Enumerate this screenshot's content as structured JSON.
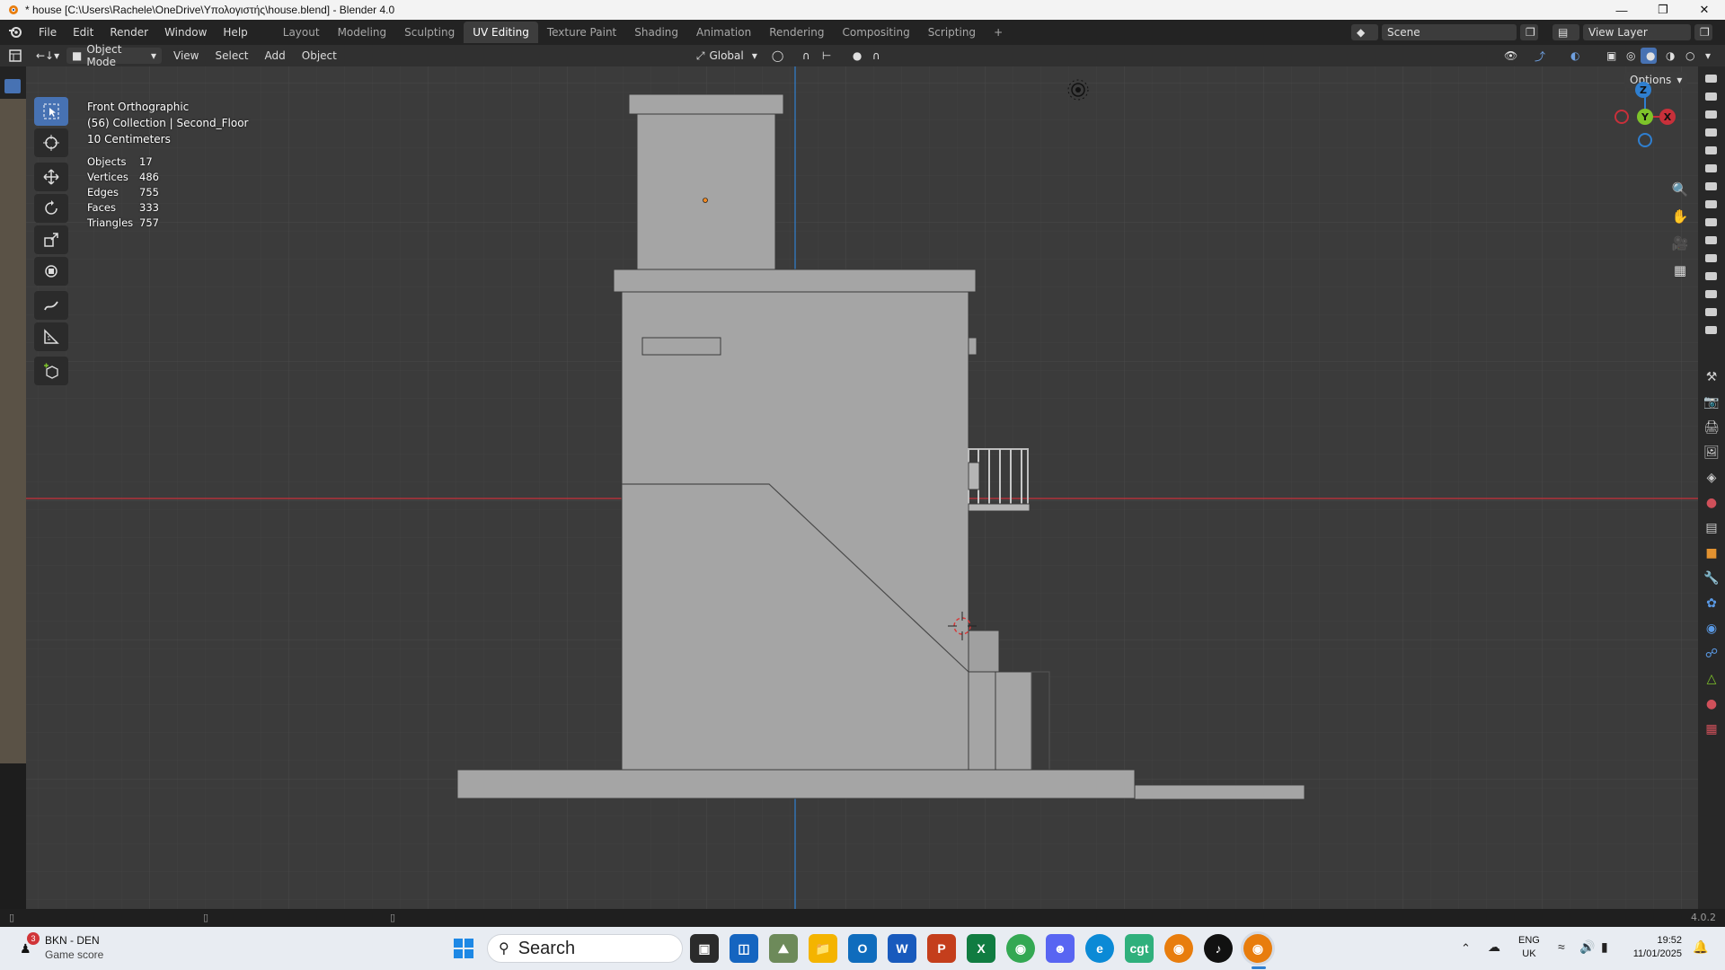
{
  "window": {
    "title": "* house [C:\\Users\\Rachele\\OneDrive\\Υπολογιστής\\house.blend] - Blender 4.0"
  },
  "menu": [
    "File",
    "Edit",
    "Render",
    "Window",
    "Help"
  ],
  "workspaces": [
    "Layout",
    "Modeling",
    "Sculpting",
    "UV Editing",
    "Texture Paint",
    "Shading",
    "Animation",
    "Rendering",
    "Compositing",
    "Scripting"
  ],
  "active_workspace": "UV Editing",
  "scene": {
    "name": "Scene",
    "view_layer": "View Layer"
  },
  "header": {
    "mode": "Object Mode",
    "view": "View",
    "select": "Select",
    "add": "Add",
    "object": "Object",
    "orientation": "Global",
    "options": "Options"
  },
  "viewport": {
    "view_name": "Front Orthographic",
    "collection": "(56) Collection | Second_Floor",
    "grid_scale": "10 Centimeters",
    "stats": [
      {
        "label": "Objects",
        "value": "17"
      },
      {
        "label": "Vertices",
        "value": "486"
      },
      {
        "label": "Edges",
        "value": "755"
      },
      {
        "label": "Faces",
        "value": "333"
      },
      {
        "label": "Triangles",
        "value": "757"
      }
    ],
    "gizmo": {
      "z": "Z",
      "y": "Y",
      "x": "X"
    }
  },
  "statusbar": {
    "version": "4.0.2"
  },
  "taskbar": {
    "notification": {
      "title": "BKN - DEN",
      "subtitle": "Game score",
      "badge": "3"
    },
    "search_placeholder": "Search",
    "lang_top": "ENG",
    "lang_bottom": "UK",
    "time": "19:52",
    "date": "11/01/2025"
  },
  "colors": {
    "viewport_bg": "#3b3b3b",
    "mesh": "#a5a5a5",
    "accent": "#4772b3",
    "x_axis": "#c8303a",
    "y_axis": "#7ec42a",
    "z_axis": "#2f7fd0"
  }
}
